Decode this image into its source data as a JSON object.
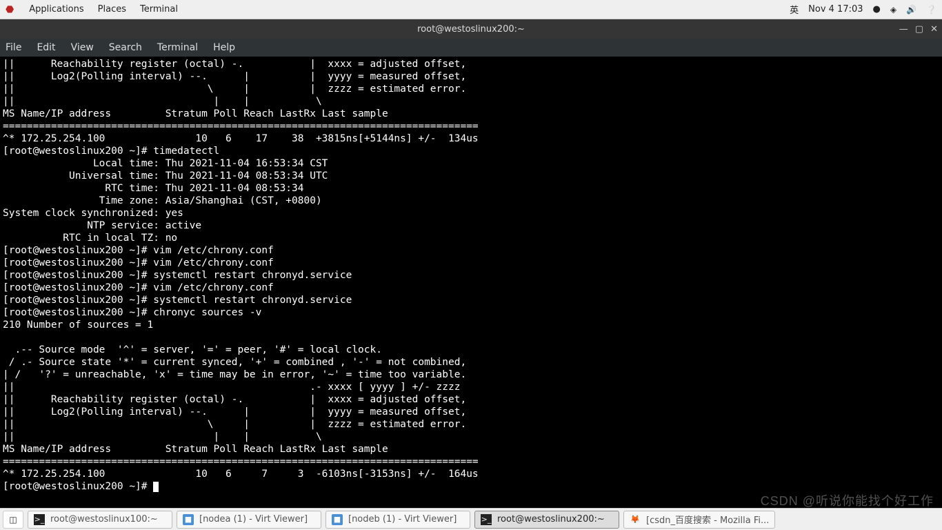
{
  "topbar": {
    "applications": "Applications",
    "places": "Places",
    "terminal_app": "Terminal",
    "input_method": "英",
    "datetime": "Nov 4  17:03",
    "dot": "●"
  },
  "window": {
    "title": "root@westoslinux200:~",
    "btn_min": "—",
    "btn_max": "▢",
    "btn_close": "✕"
  },
  "menubar": {
    "file": "File",
    "edit": "Edit",
    "view": "View",
    "search": "Search",
    "terminal": "Terminal",
    "help": "Help"
  },
  "terminal": {
    "lines": [
      "||      Reachability register (octal) -.           |  xxxx = adjusted offset,",
      "||      Log2(Polling interval) --.      |          |  yyyy = measured offset,",
      "||                                \\     |          |  zzzz = estimated error.",
      "||                                 |    |           \\",
      "MS Name/IP address         Stratum Poll Reach LastRx Last sample",
      "===============================================================================",
      "^* 172.25.254.100               10   6    17    38  +3815ns[+5144ns] +/-  134us",
      "[root@westoslinux200 ~]# timedatectl",
      "               Local time: Thu 2021-11-04 16:53:34 CST",
      "           Universal time: Thu 2021-11-04 08:53:34 UTC",
      "                 RTC time: Thu 2021-11-04 08:53:34",
      "                Time zone: Asia/Shanghai (CST, +0800)",
      "System clock synchronized: yes",
      "              NTP service: active",
      "          RTC in local TZ: no",
      "[root@westoslinux200 ~]# vim /etc/chrony.conf",
      "[root@westoslinux200 ~]# vim /etc/chrony.conf",
      "[root@westoslinux200 ~]# systemctl restart chronyd.service",
      "[root@westoslinux200 ~]# vim /etc/chrony.conf",
      "[root@westoslinux200 ~]# systemctl restart chronyd.service",
      "[root@westoslinux200 ~]# chronyc sources -v",
      "210 Number of sources = 1",
      "",
      "  .-- Source mode  '^' = server, '=' = peer, '#' = local clock.",
      " / .- Source state '*' = current synced, '+' = combined , '-' = not combined,",
      "| /   '?' = unreachable, 'x' = time may be in error, '~' = time too variable.",
      "||                                                 .- xxxx [ yyyy ] +/- zzzz",
      "||      Reachability register (octal) -.           |  xxxx = adjusted offset,",
      "||      Log2(Polling interval) --.      |          |  yyyy = measured offset,",
      "||                                \\     |          |  zzzz = estimated error.",
      "||                                 |    |           \\",
      "MS Name/IP address         Stratum Poll Reach LastRx Last sample",
      "===============================================================================",
      "^* 172.25.254.100               10   6     7     3  -6103ns[-3153ns] +/-  164us",
      "[root@westoslinux200 ~]# "
    ]
  },
  "taskbar": {
    "items": [
      {
        "icon": "term",
        "label": "root@westoslinux100:~",
        "active": false
      },
      {
        "icon": "vv",
        "label": "[nodea (1) - Virt Viewer]",
        "active": false
      },
      {
        "icon": "vv",
        "label": "[nodeb (1) - Virt Viewer]",
        "active": false
      },
      {
        "icon": "term",
        "label": "root@westoslinux200:~",
        "active": true
      },
      {
        "icon": "ff",
        "label": "[csdn_百度搜索 - Mozilla Fi...",
        "active": false
      }
    ]
  },
  "watermark": "CSDN @听说你能找个好工作"
}
